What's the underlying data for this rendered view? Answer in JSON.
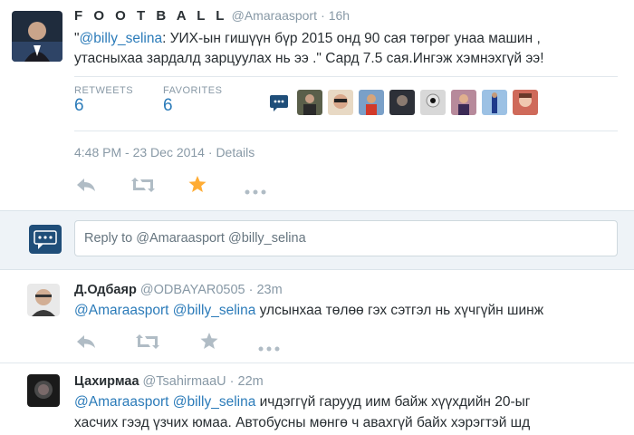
{
  "main_tweet": {
    "display_name": "F O O T B A L L",
    "handle": "@Amaraasport",
    "time": "16h",
    "text_quote_open": "\"",
    "mention": "@billy_selina",
    "text_line1": ": УИХ-ын гишүүн бүр  2015 онд 90 сая төгрөг унаа машин ,",
    "text_line2": "утасныхаа зардалд зарцуулах нь ээ .\" Сард 7.5 сая.Ингэж хэмнэхгүй ээ!",
    "retweets_label": "RETWEETS",
    "retweets_count": "6",
    "favorites_label": "FAVORITES",
    "favorites_count": "6",
    "timestamp": "4:48 PM - 23 Dec 2014",
    "details_sep": " · ",
    "details_label": "Details"
  },
  "reply_box": {
    "prefix": "Reply to ",
    "mentions": "@Amaraasport @billy_selina"
  },
  "replies": [
    {
      "display_name": "Д.Одбаяр",
      "handle": "@ODBAYAR0505",
      "time": "23m",
      "mention1": "@Amaraasport",
      "mention2": "@billy_selina",
      "text_line1": " улсынхаа төлөө гэх сэтгэл нь хүчгүйн шинж",
      "text_line2": ""
    },
    {
      "display_name": "Цахирмаа",
      "handle": "@TsahirmaaU",
      "time": "22m",
      "mention1": "@Amaraasport",
      "mention2": "@billy_selina",
      "text_line1": " ичдэггүй гарууд иим байж хүүхдийн 20-ыг",
      "text_line2": "хасчих гээд үзчих юмаа. Автобусны мөнгө ч авахгүй байх хэрэгтэй шд"
    }
  ],
  "colors": {
    "link": "#2b7bb9",
    "muted": "#8899a6",
    "favorite_active": "#ffac33",
    "reply_band": "#eef3f7"
  },
  "icons": [
    "reply-icon",
    "retweet-icon",
    "favorite-icon",
    "more-icon",
    "reply-box-icon"
  ]
}
